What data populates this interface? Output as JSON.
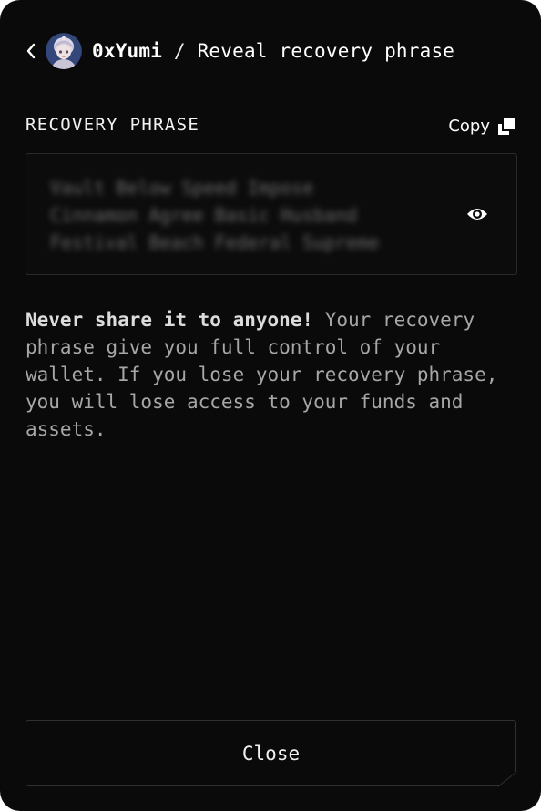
{
  "header": {
    "username": "0xYumi",
    "separator": " / ",
    "title": "Reveal recovery phrase",
    "back_icon": "chevron-left-icon",
    "avatar_icon": "avatar"
  },
  "phrase_section": {
    "label": "RECOVERY PHRASE",
    "copy_label": "Copy",
    "copy_icon": "copy-icon",
    "phrase_lines": [
      "Vault Below Speed Impose",
      "Cinnamon Agree Basic Husband",
      "Festival Beach Federal Supreme"
    ],
    "reveal_icon": "eye-icon"
  },
  "warning": {
    "emphasis": "Never share it to anyone!",
    "body": " Your recovery phrase give you full control of your wallet. If you lose your recovery phrase, you will lose access to your funds and assets."
  },
  "footer": {
    "close_label": "Close"
  },
  "colors": {
    "background": "#0a0a0a",
    "border": "#2a2a2a",
    "text": "#ffffff",
    "muted_text": "#a7a7a7"
  }
}
